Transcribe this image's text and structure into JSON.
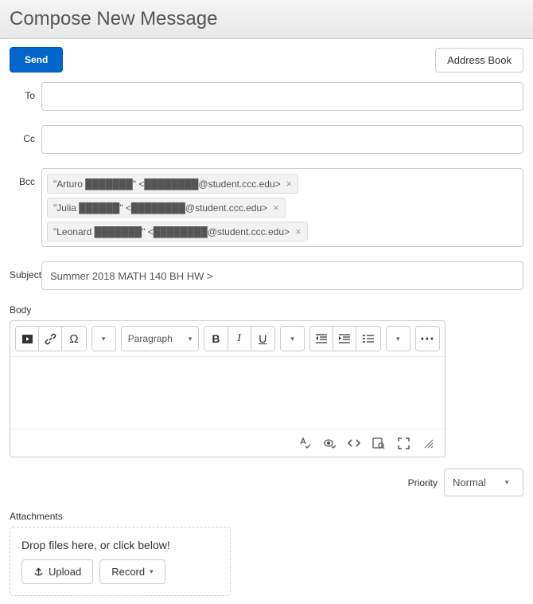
{
  "header": {
    "title": "Compose New Message"
  },
  "actions": {
    "send": "Send",
    "addressBook": "Address Book"
  },
  "fields": {
    "to": {
      "label": "To",
      "value": ""
    },
    "cc": {
      "label": "Cc",
      "value": ""
    },
    "bcc": {
      "label": "Bcc",
      "chips": [
        "\"Arturo ███████\" <████████@student.ccc.edu>",
        "\"Julia ██████\" <████████@student.ccc.edu>",
        "\"Leonard ███████\" <████████@student.ccc.edu>"
      ]
    },
    "subject": {
      "label": "Subject",
      "value": "Summer 2018 MATH 140 BH HW >"
    }
  },
  "body": {
    "label": "Body"
  },
  "toolbar": {
    "paragraphLabel": "Paragraph",
    "bold": "B",
    "italic": "I",
    "underline": "U",
    "omega": "Ω",
    "more": "⋯"
  },
  "priority": {
    "label": "Priority",
    "value": "Normal"
  },
  "attachments": {
    "label": "Attachments",
    "dropText": "Drop files here, or click below!",
    "upload": "Upload",
    "record": "Record"
  }
}
